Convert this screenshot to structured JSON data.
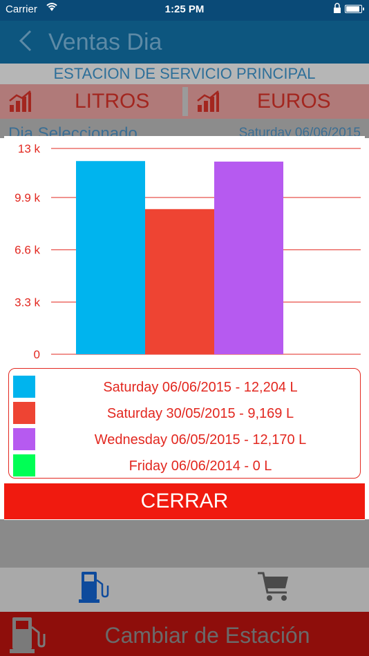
{
  "status_bar": {
    "carrier": "Carrier",
    "time": "1:25 PM"
  },
  "nav": {
    "title": "Ventas Dia"
  },
  "station": {
    "name": "ESTACION DE SERVICIO PRINCIPAL"
  },
  "tabs": {
    "litros": "LITROS",
    "euros": "EUROS"
  },
  "day": {
    "label": "Dia Seleccionado",
    "value": "Saturday 06/06/2015"
  },
  "colors": {
    "accent": "#e2271f",
    "close": "#f01a0f"
  },
  "chart_data": {
    "type": "bar",
    "categories": [
      "Saturday 06/06/2015",
      "Saturday 30/05/2015",
      "Wednesday 06/05/2015",
      "Friday 06/06/2014"
    ],
    "values": [
      12204,
      9169,
      12170,
      0
    ],
    "colors": [
      "#00b4ee",
      "#ee4433",
      "#b65af0",
      "#00ff55"
    ],
    "ylim": [
      0,
      13000
    ],
    "yticks": [
      0,
      3300,
      6600,
      9900,
      13000
    ],
    "ytick_labels": [
      "0",
      "3.3 k",
      "6.6 k",
      "9.9 k",
      "13 k"
    ],
    "grid": true,
    "legend": "bottom"
  },
  "legend": {
    "items": [
      {
        "label": "Saturday 06/06/2015 - 12,204 L",
        "color": "#00b4ee"
      },
      {
        "label": "Saturday 30/05/2015 - 9,169 L",
        "color": "#ee4433"
      },
      {
        "label": "Wednesday 06/05/2015 - 12,170 L",
        "color": "#b65af0"
      },
      {
        "label": "Friday 06/06/2014 - 0 L",
        "color": "#00ff55"
      }
    ]
  },
  "close_button": {
    "label": "CERRAR"
  },
  "tab_bar": {
    "icons": [
      "fuel-pump-icon",
      "shopping-cart-icon"
    ]
  },
  "footer": {
    "label": "Cambiar de Estación"
  }
}
